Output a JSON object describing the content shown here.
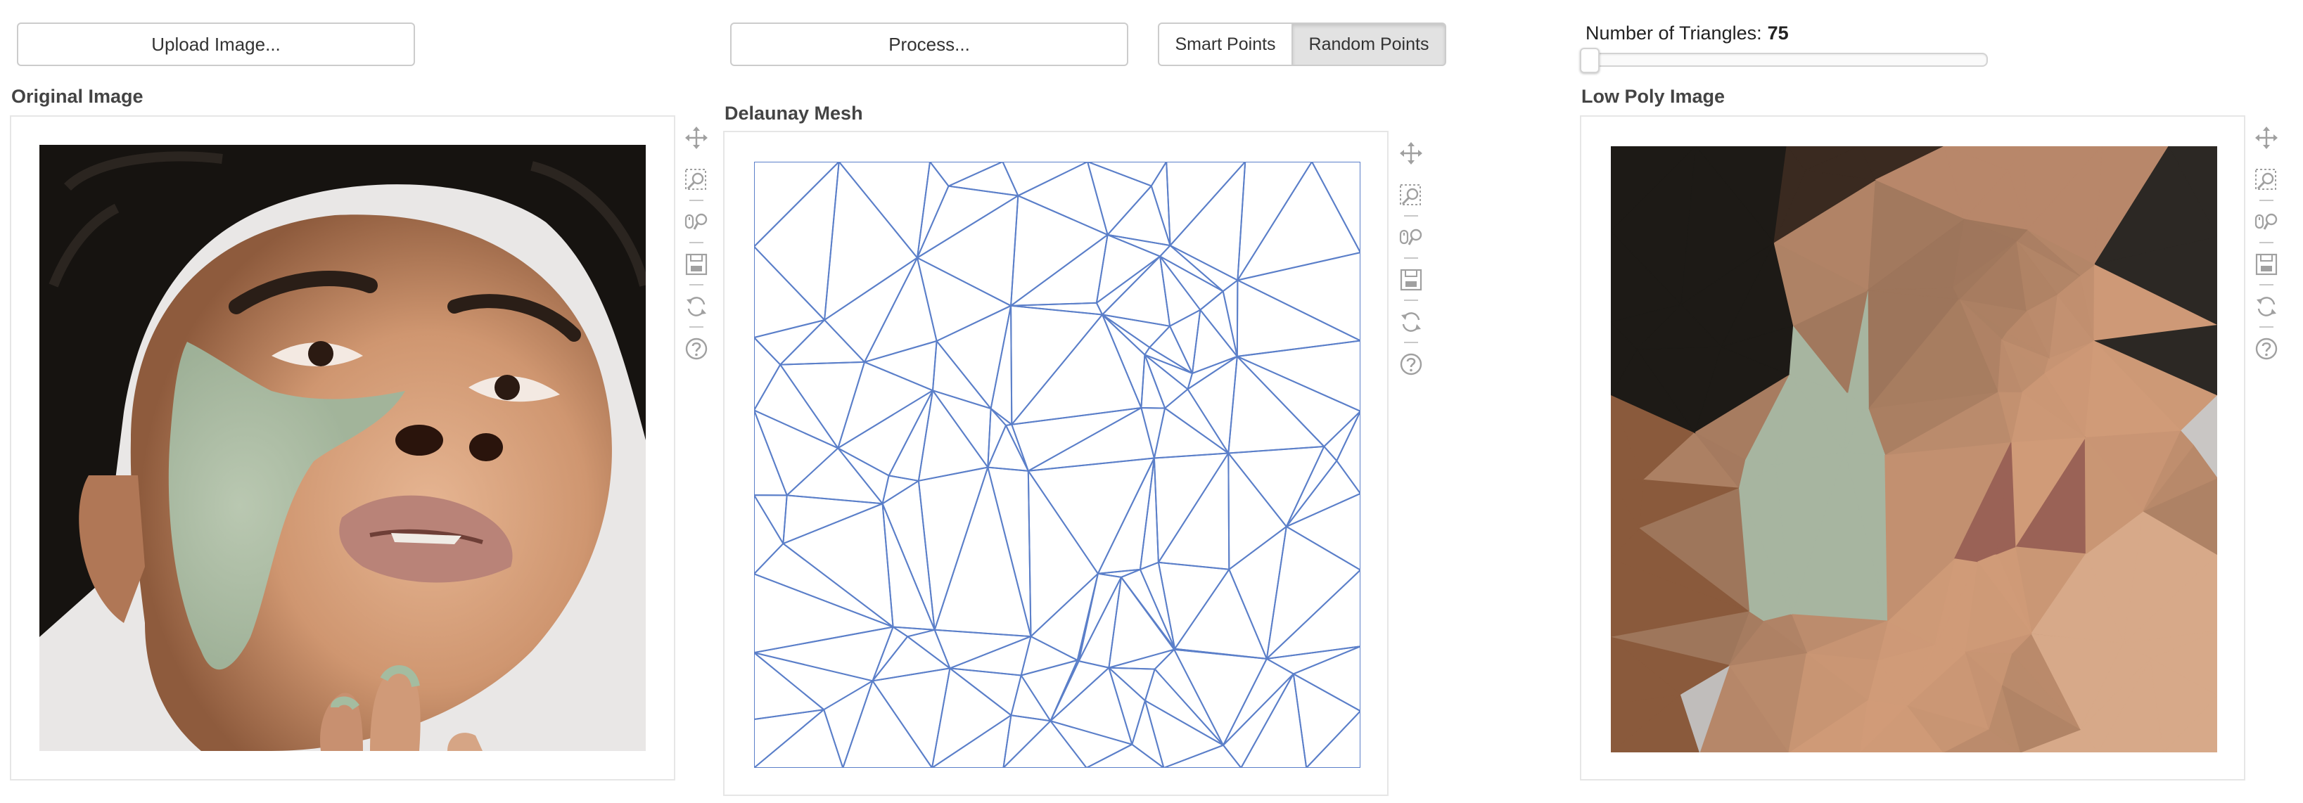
{
  "buttons": {
    "upload": "Upload Image...",
    "process": "Process..."
  },
  "point_mode": {
    "options": [
      "Smart Points",
      "Random Points"
    ],
    "selected": "Random Points"
  },
  "slider": {
    "label": "Number of Triangles:",
    "value": "75",
    "fraction": 0.0
  },
  "panels": {
    "original": {
      "title": "Original Image"
    },
    "mesh": {
      "title": "Delaunay Mesh",
      "line_color": "#5b7fc9"
    },
    "lowpoly": {
      "title": "Low Poly Image"
    }
  },
  "toolbar_icons": [
    "pan-icon",
    "box-zoom-icon",
    "wheel-zoom-icon",
    "save-icon",
    "reset-icon",
    "help-icon"
  ],
  "colors": {
    "border": "#cccccc",
    "active_toggle_bg": "#e2e2e2",
    "mesh_line": "#5b7fc9",
    "icon_gray": "#a0a0a0"
  }
}
